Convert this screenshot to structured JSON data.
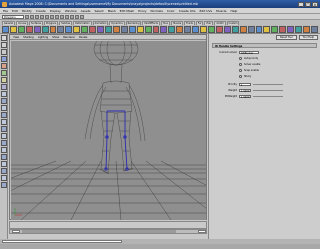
{
  "window": {
    "title": "Autodesk Maya 2008: C:\\Documents and Settings\\username\\My Documents\\maya\\projects\\default\\scenes\\untitled.mb"
  },
  "menubar": {
    "items": [
      "File",
      "Edit",
      "Modify",
      "Create",
      "Display",
      "Window",
      "Assets",
      "Select",
      "Mesh",
      "Edit Mesh",
      "Proxy",
      "Normals",
      "Color",
      "Create UVs",
      "Edit UVs",
      "Muscle",
      "Help"
    ]
  },
  "statusline": {
    "mode": "Polygons"
  },
  "shelf": {
    "tabs": [
      "General",
      "Curves",
      "Surfaces",
      "Polygons",
      "Subdivs",
      "Deformation",
      "Animation",
      "Dynamics",
      "Rendering",
      "PaintEffects",
      "Toon",
      "Muscle",
      "Fluids",
      "Fur",
      "Hair",
      "nCloth",
      "Custom"
    ]
  },
  "viewport": {
    "menu": [
      "View",
      "Shading",
      "Lighting",
      "Show",
      "Renderer",
      "Panels"
    ]
  },
  "tool_settings": {
    "buttons": {
      "reset": "Reset Tool",
      "help": "Tool Help"
    },
    "header": "IK Handle Settings",
    "current_solver_label": "Current solver",
    "current_solver_value": "ikRPsolver",
    "autopriority": "Autopriority",
    "solver_enable": "Solver enable",
    "snap_enable": "Snap enable",
    "sticky": "Sticky",
    "priority_label": "Priority",
    "priority_value": "1",
    "weight_label": "Weight",
    "weight_value": "1.0000",
    "pov_label": "POWeight",
    "pov_value": "1.0000"
  },
  "colors": {
    "titlebar": "#2f5fa8",
    "viewport_bg": "#8f8f8f",
    "grid": "#2a2a2a",
    "mesh_wire": "#3c3c3c",
    "joint_highlight": "#2a2ab0"
  },
  "icons": {
    "toolbox": [
      "select-icon",
      "lasso-icon",
      "paint-select-icon",
      "move-icon",
      "rotate-icon",
      "scale-icon",
      "manipulator-icon",
      "last-tool-icon"
    ],
    "shelf": [
      "shelf-tool-icon"
    ]
  }
}
